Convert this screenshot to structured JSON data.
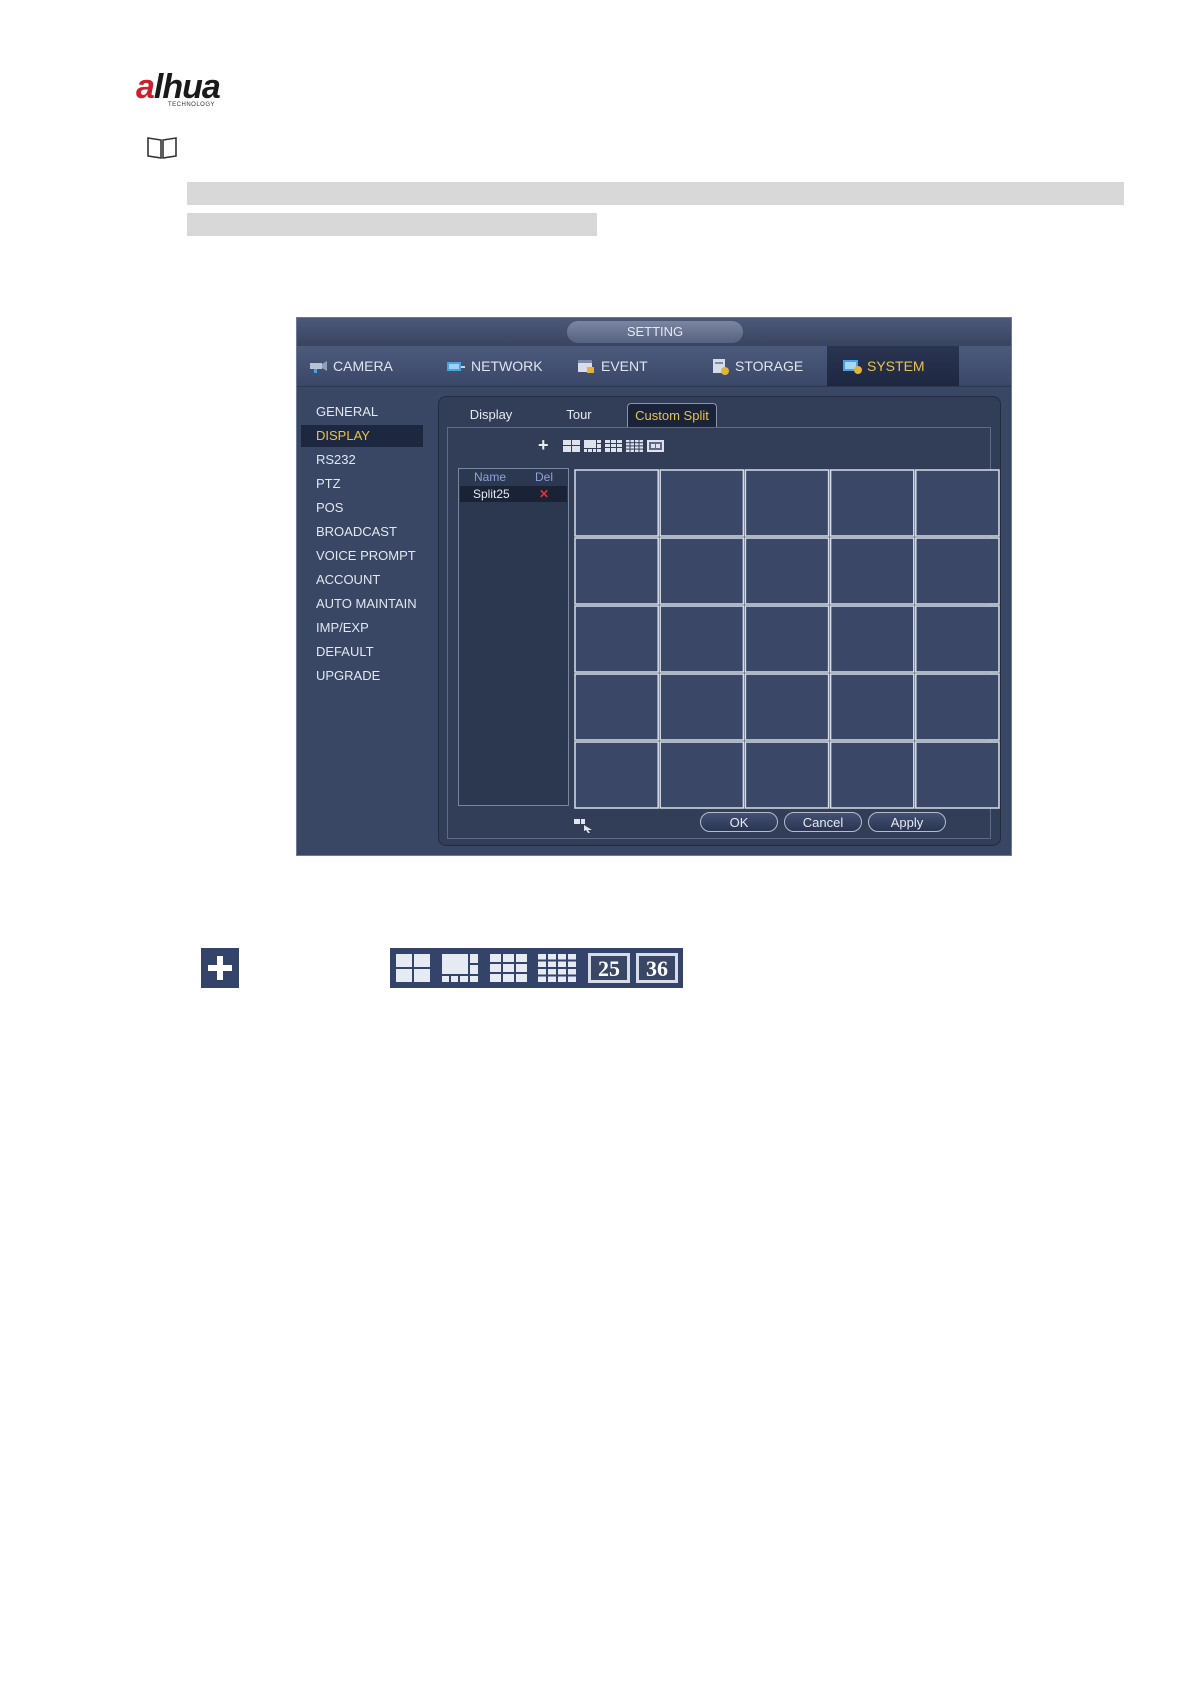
{
  "brand": {
    "logo_text_a": "a",
    "logo_text_rest": "lhua",
    "logo_sub": "TECHNOLOGY"
  },
  "window": {
    "title": "SETTING"
  },
  "main_tabs": [
    {
      "label": "CAMERA",
      "icon": "camera-icon",
      "active": false
    },
    {
      "label": "NETWORK",
      "icon": "network-icon",
      "active": false
    },
    {
      "label": "EVENT",
      "icon": "event-icon",
      "active": false
    },
    {
      "label": "STORAGE",
      "icon": "storage-icon",
      "active": false
    },
    {
      "label": "SYSTEM",
      "icon": "system-icon",
      "active": true
    }
  ],
  "sidebar": {
    "items": [
      "GENERAL",
      "DISPLAY",
      "RS232",
      "PTZ",
      "POS",
      "BROADCAST",
      "VOICE PROMPT",
      "ACCOUNT",
      "AUTO MAINTAIN",
      "IMP/EXP",
      "DEFAULT",
      "UPGRADE"
    ],
    "active": "DISPLAY"
  },
  "sub_tabs": [
    {
      "label": "Display",
      "active": false
    },
    {
      "label": "Tour",
      "active": false
    },
    {
      "label": "Custom Split",
      "active": true
    }
  ],
  "toolbar": {
    "add_symbol": "+",
    "layout_icons": [
      "split-4-icon",
      "split-8-icon",
      "split-9-icon",
      "split-16-icon",
      "split-25-icon"
    ]
  },
  "split_list": {
    "col_name": "Name",
    "col_del": "Del",
    "rows": [
      {
        "name": "Split25",
        "del_symbol": "✕"
      }
    ]
  },
  "split_grid": {
    "rows": 5,
    "cols": 5
  },
  "buttons": {
    "ok": "OK",
    "cancel": "Cancel",
    "apply": "Apply"
  },
  "lower_icons": {
    "plus": "+",
    "labels": {
      "split25": "25",
      "split36": "36"
    }
  },
  "colors": {
    "accent": "#e8c34a",
    "window_bg": "#3a4764",
    "delete": "#e0313a"
  }
}
